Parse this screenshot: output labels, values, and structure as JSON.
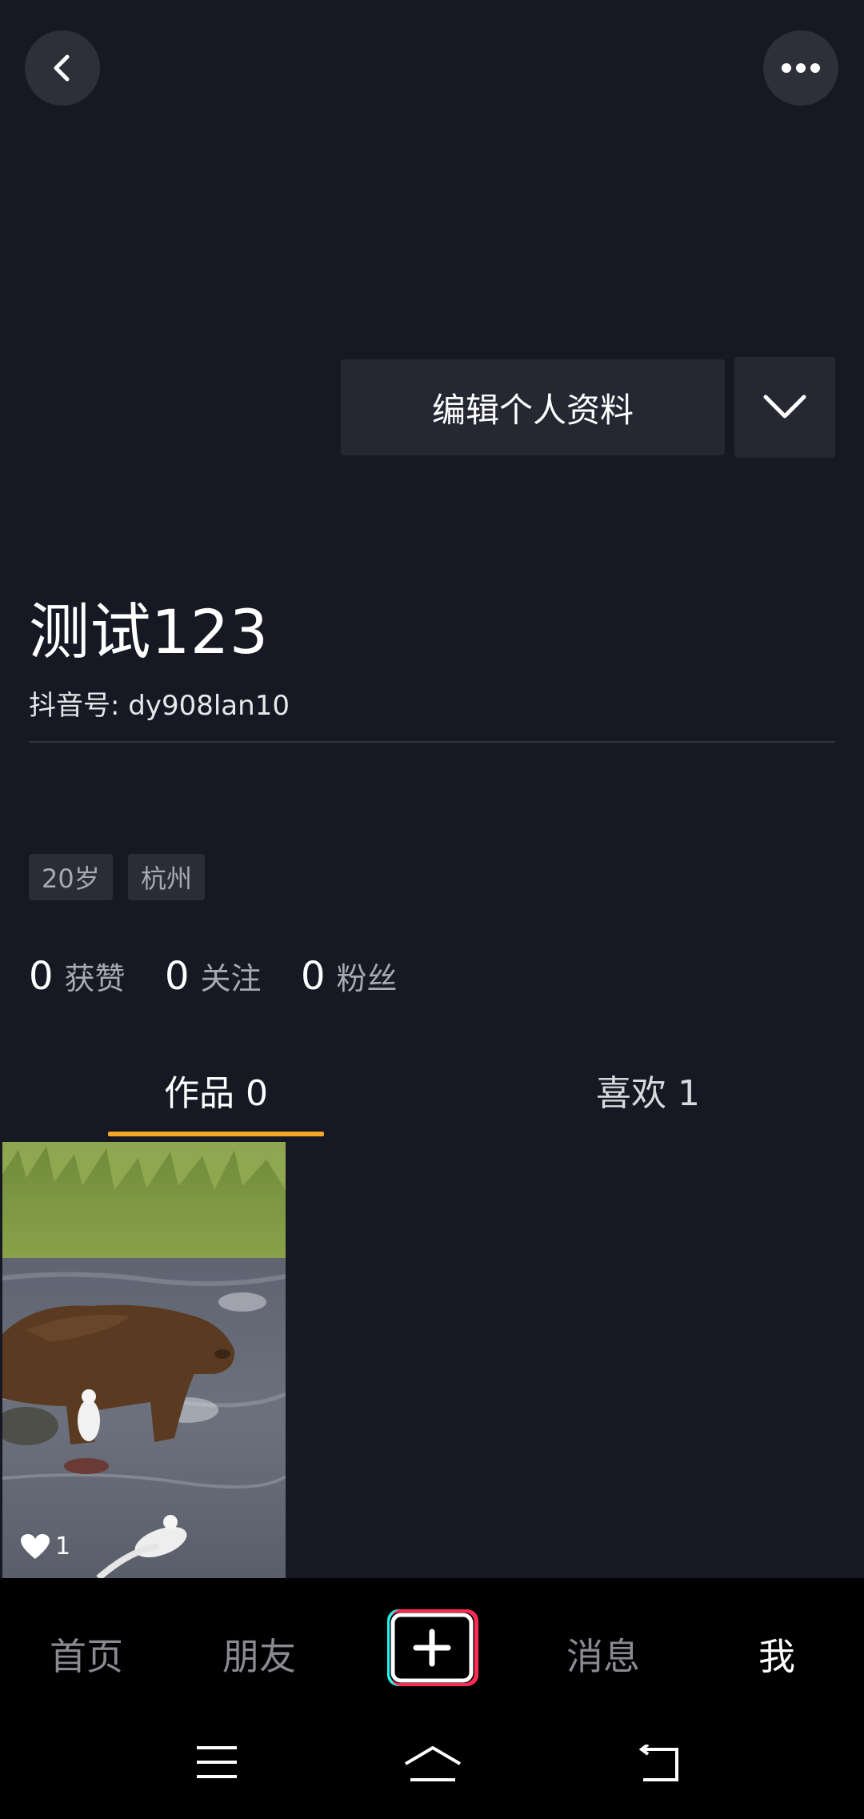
{
  "header": {
    "back_icon": "chevron-left-icon",
    "more_icon": "more-dots-icon",
    "edit_profile_label": "编辑个人资料",
    "dropdown_icon": "chevron-down-icon"
  },
  "profile": {
    "name": "测试123",
    "handle": "抖音号: dy908lan10",
    "tags": [
      "20岁",
      "杭州"
    ]
  },
  "stats": [
    {
      "num": "0",
      "label": "获赞"
    },
    {
      "num": "0",
      "label": "关注"
    },
    {
      "num": "0",
      "label": "粉丝"
    }
  ],
  "tabs": [
    {
      "label": "作品 0",
      "active": true
    },
    {
      "label": "喜欢 1",
      "active": false
    }
  ],
  "video": {
    "likes": "1",
    "like_icon": "heart-icon"
  },
  "bottom_nav": {
    "home": "首页",
    "friends": "朋友",
    "add_icon": "plus-icon",
    "messages": "消息",
    "me": "我"
  },
  "system_nav": {
    "menu_icon": "menu-icon",
    "home_icon": "home-icon",
    "back_icon": "back-icon"
  },
  "colors": {
    "background": "#161823",
    "accent": "#f5a623",
    "nav_bar": "#000000"
  }
}
